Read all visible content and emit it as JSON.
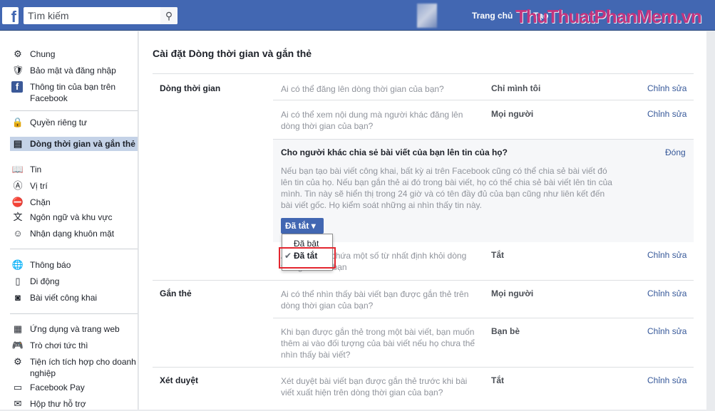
{
  "header": {
    "search_placeholder": "Tìm kiếm",
    "home": "Trang chủ",
    "create": "Tạo",
    "watermark": "ThuThuatPhanMem.vn"
  },
  "sidebar": {
    "items": [
      {
        "label": "Chung",
        "icon": "gear-icon"
      },
      {
        "label": "Bảo mật và đăng nhập",
        "icon": "shield-icon"
      },
      {
        "label": "Thông tin của bạn trên Facebook",
        "icon": "facebook-icon"
      },
      {
        "label": "Quyền riêng tư",
        "icon": "lock-icon"
      },
      {
        "label": "Dòng thời gian và gắn thẻ",
        "icon": "timeline-icon"
      },
      {
        "label": "Tin",
        "icon": "book-icon"
      },
      {
        "label": "Vị trí",
        "icon": "location-icon"
      },
      {
        "label": "Chặn",
        "icon": "block-icon"
      },
      {
        "label": "Ngôn ngữ và khu vực",
        "icon": "language-icon"
      },
      {
        "label": "Nhận dạng khuôn mặt",
        "icon": "face-icon"
      },
      {
        "label": "Thông báo",
        "icon": "globe-icon"
      },
      {
        "label": "Di động",
        "icon": "mobile-icon"
      },
      {
        "label": "Bài viết công khai",
        "icon": "rss-icon"
      },
      {
        "label": "Ứng dụng và trang web",
        "icon": "apps-icon"
      },
      {
        "label": "Trò chơi tức thì",
        "icon": "gamepad-icon"
      },
      {
        "label": "Tiện ích tích hợp cho doanh nghiệp",
        "icon": "business-icon"
      },
      {
        "label": "Facebook Pay",
        "icon": "card-icon"
      },
      {
        "label": "Hộp thư hỗ trợ",
        "icon": "inbox-icon"
      }
    ]
  },
  "main": {
    "title": "Cài đặt Dòng thời gian và gắn thẻ",
    "sections": {
      "timeline": "Dòng thời gian",
      "tagging": "Gắn thẻ",
      "review": "Xét duyệt"
    },
    "rows": [
      {
        "q": "Ai có thể đăng lên dòng thời gian của bạn?",
        "v": "Chỉ mình tôi",
        "e": "Chỉnh sửa"
      },
      {
        "q": "Ai có thể xem nội dung mà người khác đăng lên dòng thời gian của bạn?",
        "v": "Mọi người",
        "e": "Chỉnh sửa"
      },
      {
        "q": "Ẩn bình luận chứa một số từ nhất định khỏi dòng thời gian của bạn",
        "v": "Tắt",
        "e": "Chỉnh sửa"
      },
      {
        "q": "Ai có thể nhìn thấy bài viết bạn được gắn thẻ trên dòng thời gian của bạn?",
        "v": "Mọi người",
        "e": "Chỉnh sửa"
      },
      {
        "q": "Khi bạn được gắn thẻ trong một bài viết, bạn muốn thêm ai vào đối tượng của bài viết nếu họ chưa thể nhìn thấy bài viết?",
        "v": "Bạn bè",
        "e": "Chỉnh sửa"
      },
      {
        "q": "Xét duyệt bài viết bạn được gắn thẻ trước khi bài viết xuất hiện trên dòng thời gian của bạn?",
        "v": "Tắt",
        "e": "Chỉnh sửa"
      }
    ],
    "expanded": {
      "q": "Cho người khác chia sẻ bài viết của bạn lên tin của họ?",
      "close": "Đóng",
      "desc": "Nếu bạn tạo bài viết công khai, bất kỳ ai trên Facebook cũng có thể chia sẻ bài viết đó lên tin của họ. Nếu bạn gắn thẻ ai đó trong bài viết, họ có thể chia sẻ bài viết lên tin của mình. Tin này sẽ hiển thị trong 24 giờ và có tên đầy đủ của bạn cũng như liên kết đến bài viết gốc. Họ kiểm soát những ai nhìn thấy tin này.",
      "selected": "Đã tắt",
      "options": [
        "Đã bật",
        "Đã tắt"
      ]
    }
  }
}
